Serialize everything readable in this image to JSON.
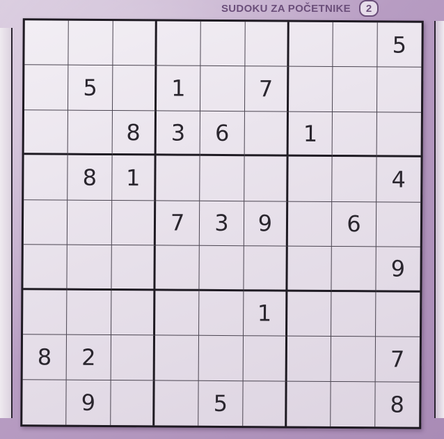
{
  "header": {
    "title": "SUDOKU ZA POČETNIKE",
    "badge": "2"
  },
  "sudoku": {
    "grid": [
      [
        "",
        "",
        "",
        "",
        "",
        "",
        "",
        "",
        "5"
      ],
      [
        "",
        "5",
        "",
        "1",
        "",
        "7",
        "",
        "",
        ""
      ],
      [
        "",
        "",
        "8",
        "3",
        "6",
        "",
        "1",
        "",
        ""
      ],
      [
        "",
        "8",
        "1",
        "",
        "",
        "",
        "",
        "",
        "4"
      ],
      [
        "",
        "",
        "",
        "7",
        "3",
        "9",
        "",
        "6",
        ""
      ],
      [
        "",
        "",
        "",
        "",
        "",
        "",
        "",
        "",
        "9"
      ],
      [
        "",
        "",
        "",
        "",
        "",
        "1",
        "",
        "",
        ""
      ],
      [
        "8",
        "2",
        "",
        "",
        "",
        "",
        "",
        "",
        "7"
      ],
      [
        "",
        "9",
        "",
        "",
        "5",
        "",
        "",
        "",
        "8"
      ]
    ]
  },
  "colors": {
    "accent": "#6b4f7a",
    "background": "#c8b4cf",
    "paper": "#ece6ee",
    "ink": "#2a262e"
  }
}
